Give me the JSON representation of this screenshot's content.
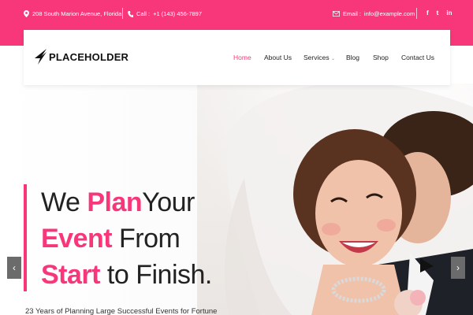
{
  "topbar": {
    "address": "208 South Marion Avenue, Florida",
    "call_label": "Call :",
    "phone": "+1 (143) 456-7897",
    "email_label": "Email :",
    "email": "info@example.com",
    "social": [
      "f",
      "t",
      "in"
    ]
  },
  "brand": {
    "logo_text": "PLACEHOLDER"
  },
  "nav": {
    "items": [
      {
        "label": "Home"
      },
      {
        "label": "About Us"
      },
      {
        "label": "Services"
      },
      {
        "label": "Blog"
      },
      {
        "label": "Shop"
      },
      {
        "label": "Contact Us"
      }
    ]
  },
  "hero": {
    "line1_a": "We ",
    "line1_b": "Plan",
    "line1_c": "Your",
    "line2_a": "Event",
    "line2_b": " From",
    "line3_a": "Start",
    "line3_b": " to Finish.",
    "subtext": "23 Years of Planning Large Successful Events for Fortune",
    "prev_arrow": "‹",
    "next_arrow": "›"
  },
  "colors": {
    "accent": "#f8377a",
    "text": "#222222"
  }
}
